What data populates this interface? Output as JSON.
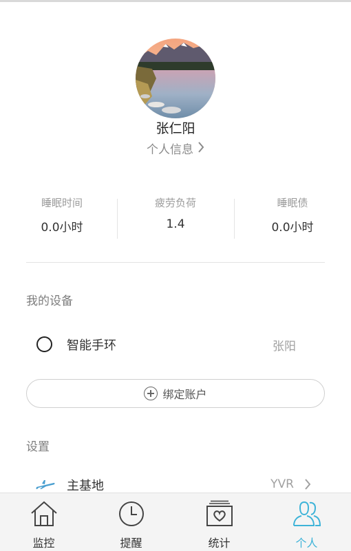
{
  "profile": {
    "name": "张仁阳",
    "info_link": "个人信息"
  },
  "stats": [
    {
      "label": "睡眠时间",
      "value": "0.0小时"
    },
    {
      "label": "疲劳负荷",
      "value": "1.4"
    },
    {
      "label": "睡眠债",
      "value": "0.0小时"
    }
  ],
  "devices": {
    "title": "我的设备",
    "items": [
      {
        "name": "智能手环",
        "owner": "张阳",
        "icon": "ring-icon"
      }
    ],
    "bind_button": "绑定账户"
  },
  "settings": {
    "title": "设置",
    "home_base_label": "主基地",
    "home_base_value": "YVR"
  },
  "tabs": [
    {
      "label": "监控",
      "icon": "home-icon"
    },
    {
      "label": "提醒",
      "icon": "clock-icon"
    },
    {
      "label": "统计",
      "icon": "stats-card-icon"
    },
    {
      "label": "个人",
      "icon": "users-icon",
      "active": true
    }
  ],
  "colors": {
    "accent": "#3db3d8",
    "plane_icon": "#4a9fd0"
  }
}
